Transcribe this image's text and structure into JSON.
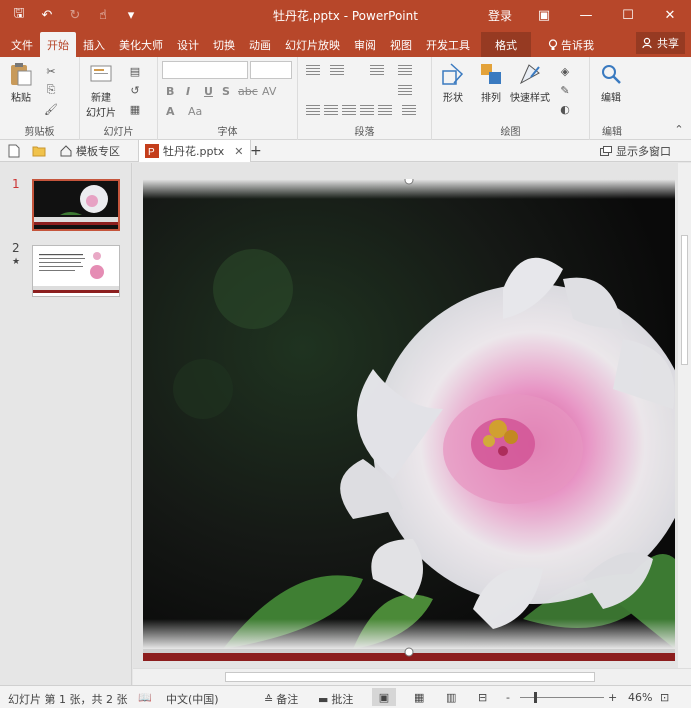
{
  "titlebar": {
    "doc_title": "牡丹花.pptx  -  PowerPoint",
    "login": "登录",
    "qat": [
      "save-icon",
      "undo-icon",
      "redo-icon",
      "touch-mode-icon",
      "customize-icon"
    ],
    "qat_glyphs": {
      "save": "🖫",
      "undo": "↶",
      "redo": "↻",
      "touch": "☝",
      "customize": "▾"
    },
    "win_glyphs": {
      "ribbon": "▣",
      "min": "—",
      "max": "☐",
      "close": "✕"
    }
  },
  "tabs": {
    "items": [
      "文件",
      "开始",
      "插入",
      "美化大师",
      "设计",
      "切换",
      "动画",
      "幻灯片放映",
      "审阅",
      "视图",
      "开发工具"
    ],
    "format": "格式",
    "tell": "告诉我",
    "share": "共享"
  },
  "ribbon": {
    "clipboard": {
      "label": "剪贴板",
      "paste": "粘贴"
    },
    "slides": {
      "label": "幻灯片",
      "new_slide_1": "新建",
      "new_slide_2": "幻灯片"
    },
    "font": {
      "label": "字体",
      "buttons": [
        "B",
        "I",
        "U",
        "S",
        "abc",
        "AV"
      ],
      "size_up": "A",
      "size_down": "Aa"
    },
    "paragraph": {
      "label": "段落"
    },
    "drawing": {
      "label": "绘图",
      "shapes": "形状",
      "arrange": "排列",
      "quick_styles": "快速样式"
    },
    "editing": {
      "label": "编辑",
      "edit": "编辑"
    }
  },
  "doctabs": {
    "template": "模板专区",
    "file": "牡丹花.pptx",
    "close": "✕",
    "add": "+",
    "multi_window": "显示多窗口"
  },
  "thumbs": [
    {
      "num": "1",
      "star": ""
    },
    {
      "num": "2",
      "star": "★"
    }
  ],
  "status": {
    "slide_info": "幻灯片 第 1 张，共 2 张",
    "language": "中文(中国)",
    "notes": "备注",
    "comments": "批注",
    "zoom_minus": "-",
    "zoom_plus": "+",
    "zoom": "46%"
  },
  "colors": {
    "accent": "#b7472a",
    "accent_dark": "#963a22",
    "ribbon_bg": "#f3f3f3"
  }
}
